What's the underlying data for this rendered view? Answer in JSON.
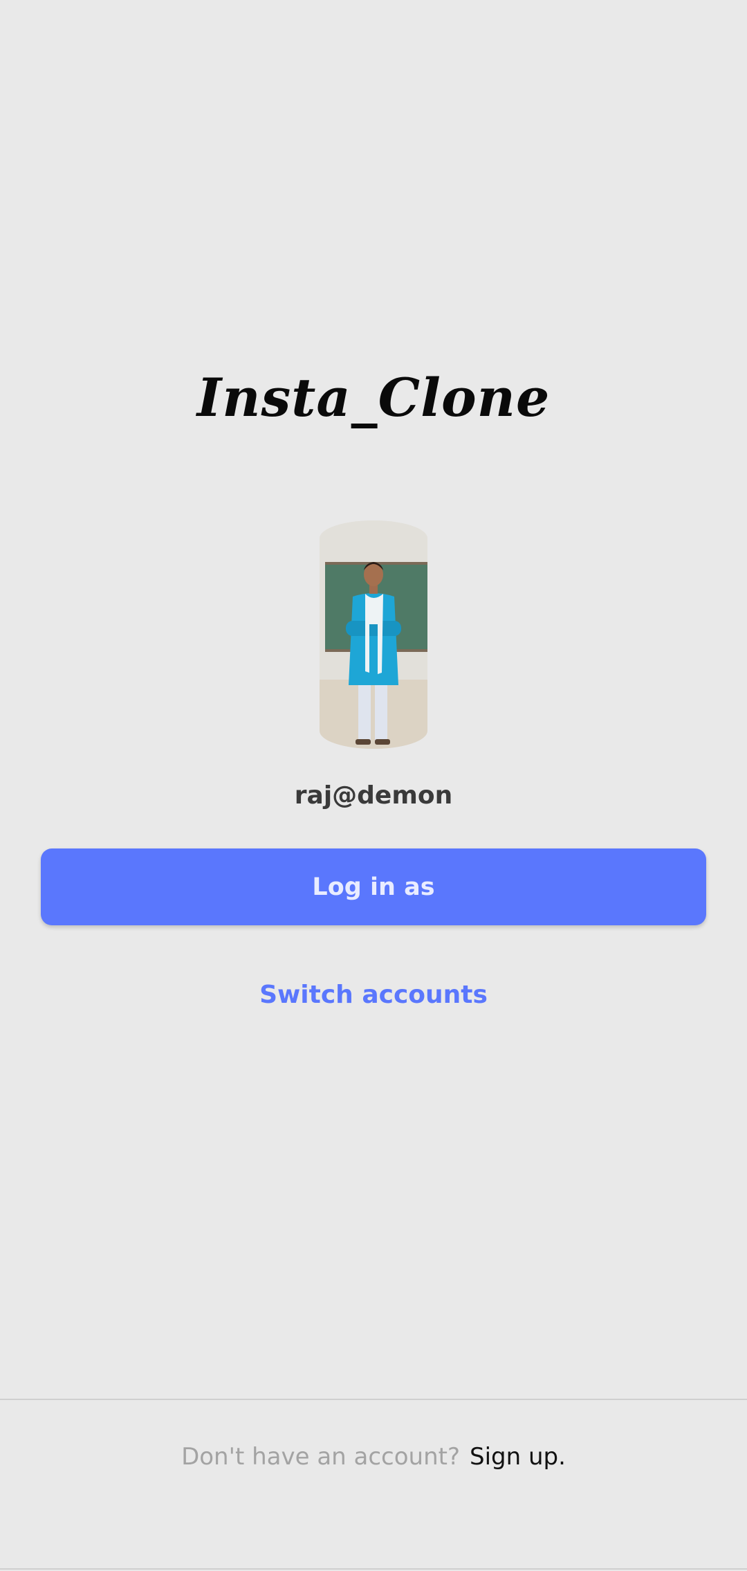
{
  "app": {
    "title": "Insta_Clone"
  },
  "profile": {
    "username": "raj@demon",
    "avatar_icon": "user-photo"
  },
  "actions": {
    "login_label": "Log in as",
    "switch_label": "Switch accounts"
  },
  "footer": {
    "prompt": "Don't have an account?",
    "signup_label": "Sign up."
  },
  "colors": {
    "background": "#e9e9e9",
    "accent": "#5a77fd",
    "text_dark": "#3a3a3a",
    "text_muted": "#a3a3a3"
  }
}
